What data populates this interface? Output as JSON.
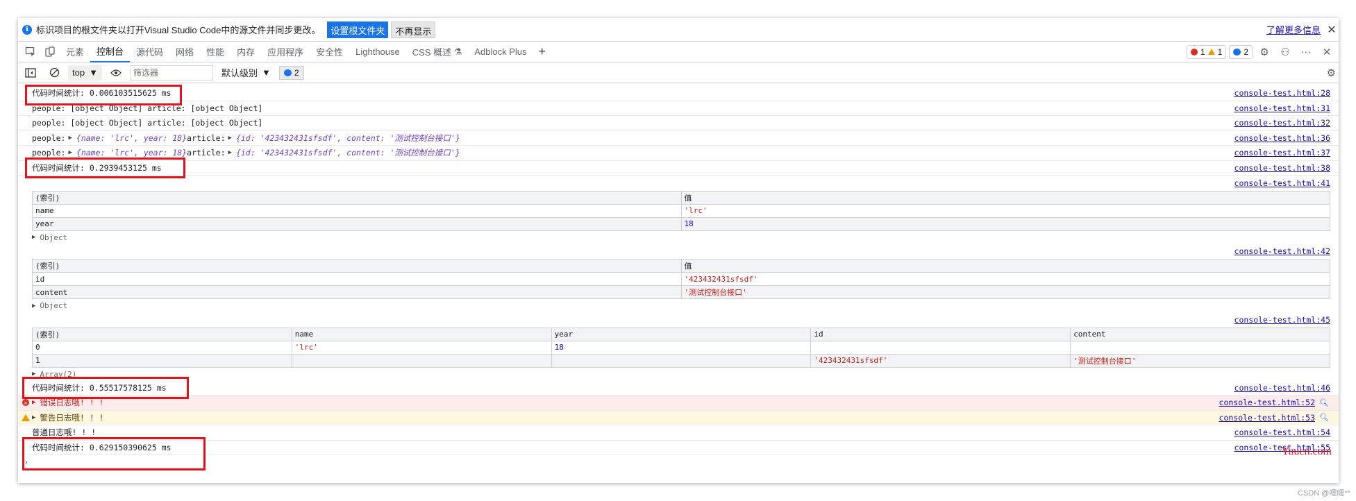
{
  "infobar": {
    "message": "标识项目的根文件夹以打开Visual Studio Code中的源文件并同步更改。",
    "set_root_button": "设置根文件夹",
    "dismiss_button": "不再显示",
    "learn_more": "了解更多信息"
  },
  "tabs": [
    "元素",
    "控制台",
    "源代码",
    "网络",
    "性能",
    "内存",
    "应用程序",
    "安全性",
    "Lighthouse",
    "CSS 概述",
    "Adblock Plus"
  ],
  "active_tab": "控制台",
  "counters": {
    "errors": "1",
    "warnings": "1",
    "messages": "2"
  },
  "console_toolbar": {
    "context": "top",
    "filter_placeholder": "筛选器",
    "levels": "默认级别",
    "message_count": "2"
  },
  "console": {
    "r1": {
      "text": "代码时间统计: 0.006103515625 ms",
      "src": "console-test.html:28"
    },
    "r2": {
      "text": "people: [object Object] article: [object Object]",
      "src": "console-test.html:31"
    },
    "r3": {
      "text": "people: [object Object] article: [object Object]",
      "src": "console-test.html:32"
    },
    "r4": {
      "prefix": "people: ",
      "people_obj": "{name: 'lrc', year: 18}",
      "mid": " article: ",
      "article_obj": "{id: '423432431sfsdf', content: '测试控制台接口'}",
      "src": "console-test.html:36"
    },
    "r5": {
      "prefix": "people: ",
      "people_obj": "{name: 'lrc', year: 18}",
      "mid": " article: ",
      "article_obj": "{id: '423432431sfsdf', content: '测试控制台接口'}",
      "src": "console-test.html:37"
    },
    "r6": {
      "text": "代码时间统计: 0.2939453125 ms",
      "src": "console-test.html:38"
    },
    "t1": {
      "src": "console-test.html:41",
      "headers": [
        "(索引)",
        "值"
      ],
      "rows": [
        [
          "name",
          "'lrc'"
        ],
        [
          "year",
          "18"
        ]
      ],
      "expander": "Object"
    },
    "t2": {
      "src": "console-test.html:42",
      "headers": [
        "(索引)",
        "值"
      ],
      "rows": [
        [
          "id",
          "'423432431sfsdf'"
        ],
        [
          "content",
          "'测试控制台接口'"
        ]
      ],
      "expander": "Object"
    },
    "t3": {
      "src": "console-test.html:45",
      "headers": [
        "(索引)",
        "name",
        "year",
        "id",
        "content"
      ],
      "rows": [
        [
          "0",
          "'lrc'",
          "18",
          "",
          ""
        ],
        [
          "1",
          "",
          "",
          "'423432431sfsdf'",
          "'测试控制台接口'"
        ]
      ],
      "expander": "Array(2)"
    },
    "r7": {
      "text": "代码时间统计: 0.55517578125 ms",
      "src": "console-test.html:46"
    },
    "r8": {
      "text": "错误日志哦! ! !",
      "src": "console-test.html:52"
    },
    "r9": {
      "text": "警告日志哦! ! !",
      "src": "console-test.html:53"
    },
    "r10": {
      "text": "普通日志哦! ! !",
      "src": "console-test.html:54"
    },
    "r11": {
      "text": "代码时间统计: 0.629150390625 ms",
      "src": "console-test.html:55"
    }
  },
  "watermarks": {
    "site": "Yuucn.com",
    "author": "CSDN @嗯嗯**"
  }
}
